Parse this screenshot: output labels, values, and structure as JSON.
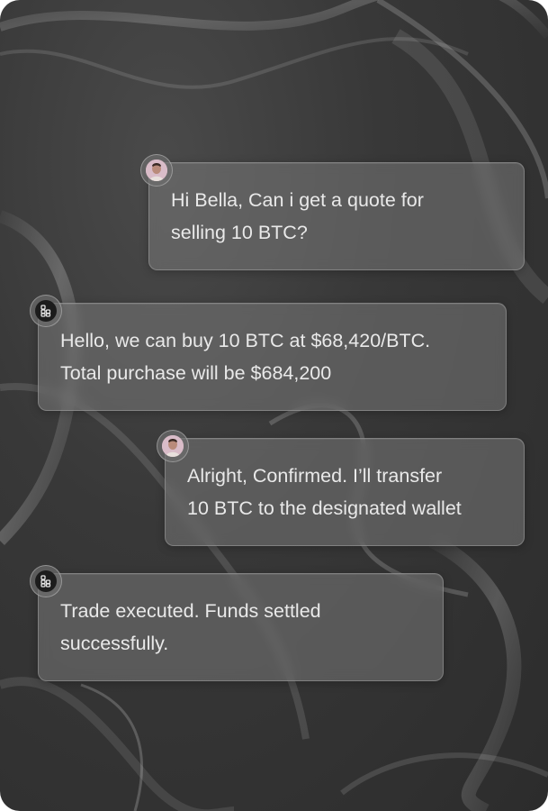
{
  "messages": [
    {
      "sender": "user",
      "lines": [
        "Hi Bella, Can i get a quote for",
        "selling 10 BTC?"
      ]
    },
    {
      "sender": "bot",
      "lines": [
        "Hello, we can buy 10 BTC at $68,420/BTC.",
        "Total purchase will be $684,200"
      ]
    },
    {
      "sender": "user",
      "lines": [
        "Alright, Confirmed. I’ll transfer",
        "10 BTC to the designated wallet"
      ]
    },
    {
      "sender": "bot",
      "lines": [
        "Trade executed. Funds settled",
        "successfully."
      ]
    }
  ],
  "icons": {
    "user_avatar": "user-avatar-icon",
    "bot_avatar": "bot-logo-icon"
  },
  "colors": {
    "background": "#333333",
    "bubble": "#7a7a7a",
    "text": "#e9e9e9",
    "user_avatar": "#d7b7c5",
    "bot_avatar": "#1c1c1c"
  }
}
